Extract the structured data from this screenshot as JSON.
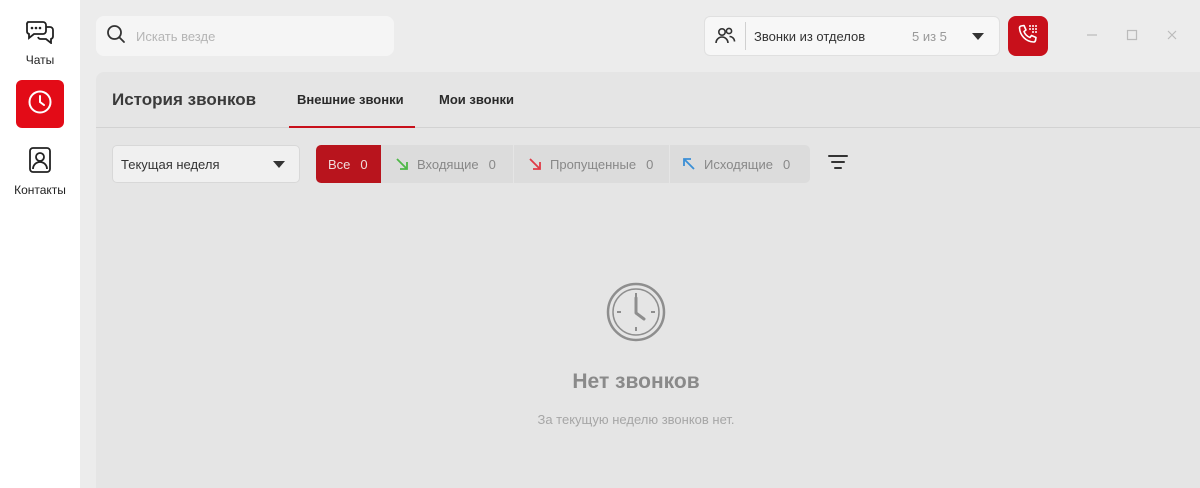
{
  "rail": {
    "chats_label": "Чаты",
    "contacts_label": "Контакты"
  },
  "search": {
    "placeholder": "Искать везде",
    "value": ""
  },
  "departments": {
    "label": "Звонки из отделов",
    "count": "5 из 5"
  },
  "header": {
    "title": "История звонков",
    "tabs": [
      {
        "label": "Внешние звонки",
        "active": true
      },
      {
        "label": "Мои звонки",
        "active": false
      }
    ]
  },
  "filters": {
    "period": "Текущая неделя",
    "chips": [
      {
        "label": "Все",
        "count": "0"
      },
      {
        "label": "Входящие",
        "count": "0"
      },
      {
        "label": "Пропущенные",
        "count": "0"
      },
      {
        "label": "Исходящие",
        "count": "0"
      }
    ]
  },
  "empty": {
    "title": "Нет звонков",
    "subtitle": "За текущую неделю звонков нет."
  },
  "colors": {
    "accent": "#e30b17",
    "accent_dim": "#b8141d",
    "incoming": "#4fb848",
    "missed": "#e03a46",
    "outgoing": "#3b8fd6"
  }
}
